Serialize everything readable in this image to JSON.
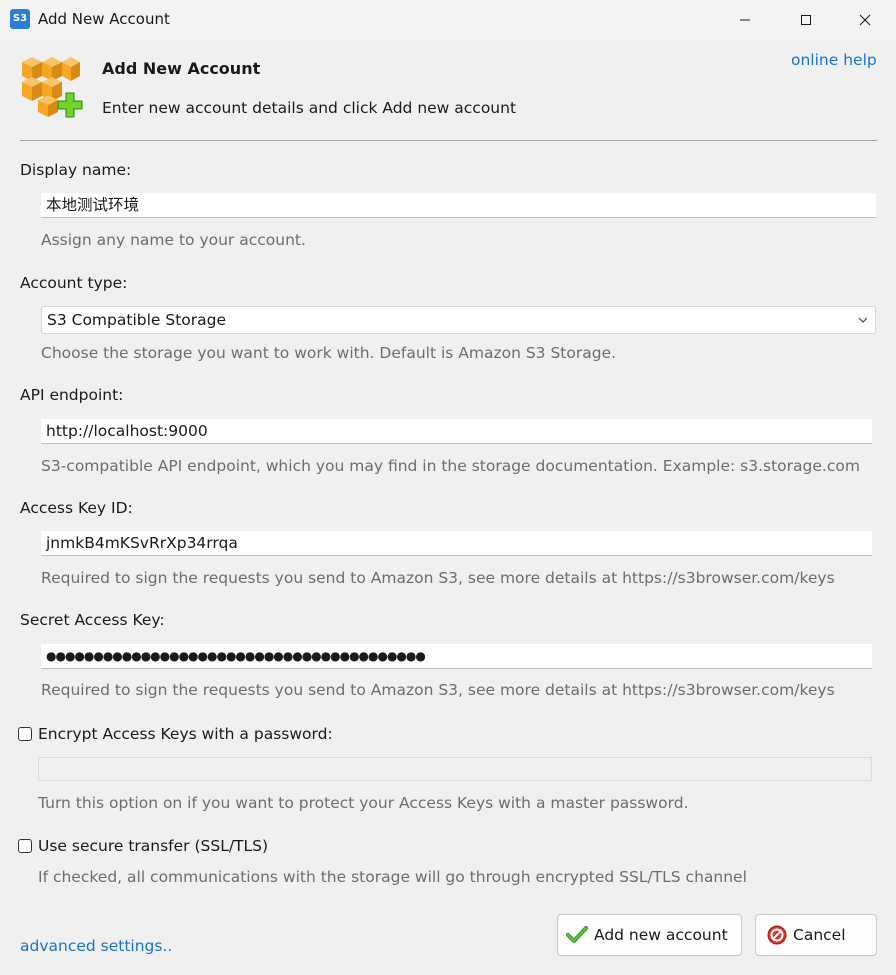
{
  "window": {
    "app_icon_text": "S3",
    "title": "Add New Account"
  },
  "header": {
    "title": "Add New Account",
    "subtitle": "Enter new account details and click Add new account",
    "online_help": "online help"
  },
  "display_name": {
    "label": "Display name:",
    "value": "本地测试环境",
    "hint": "Assign any name to your account."
  },
  "account_type": {
    "label": "Account type:",
    "selected": "S3 Compatible Storage",
    "hint": "Choose the storage you want to work with. Default is Amazon S3 Storage."
  },
  "api_endpoint": {
    "label": "API endpoint:",
    "value": "http://localhost:9000",
    "hint": "S3-compatible API endpoint, which you may find in the storage documentation. Example: s3.storage.com"
  },
  "access_key": {
    "label": "Access Key ID:",
    "value": "jnmkB4mKSvRrXp34rrqa",
    "hint": "Required to sign the requests you send to Amazon S3, see more details at https://s3browser.com/keys"
  },
  "secret_key": {
    "label": "Secret Access Key:",
    "masked_value": "●●●●●●●●●●●●●●●●●●●●●●●●●●●●●●●●●●●●●●●●",
    "hint": "Required to sign the requests you send to Amazon S3, see more details at https://s3browser.com/keys"
  },
  "encrypt": {
    "label": "Encrypt Access Keys with a password:",
    "checked": false,
    "hint": "Turn this option on if you want to protect your Access Keys with a master password."
  },
  "secure": {
    "label": "Use secure transfer (SSL/TLS)",
    "checked": false,
    "hint": "If checked, all communications with the storage will go through encrypted SSL/TLS channel"
  },
  "footer": {
    "advanced": "advanced settings..",
    "add_button": "Add new account",
    "cancel_button": "Cancel"
  },
  "colors": {
    "link": "#1a74c6",
    "hint_text": "#6d6d6d",
    "icon_orange": "#f5a623",
    "icon_green": "#5cc21a",
    "cancel_red": "#d9342b"
  },
  "icons": [
    "app-s3-icon",
    "minimize-icon",
    "maximize-icon",
    "close-icon",
    "amazon-boxes-add-icon",
    "chevron-down-icon",
    "checkmark-icon",
    "cancel-icon"
  ]
}
